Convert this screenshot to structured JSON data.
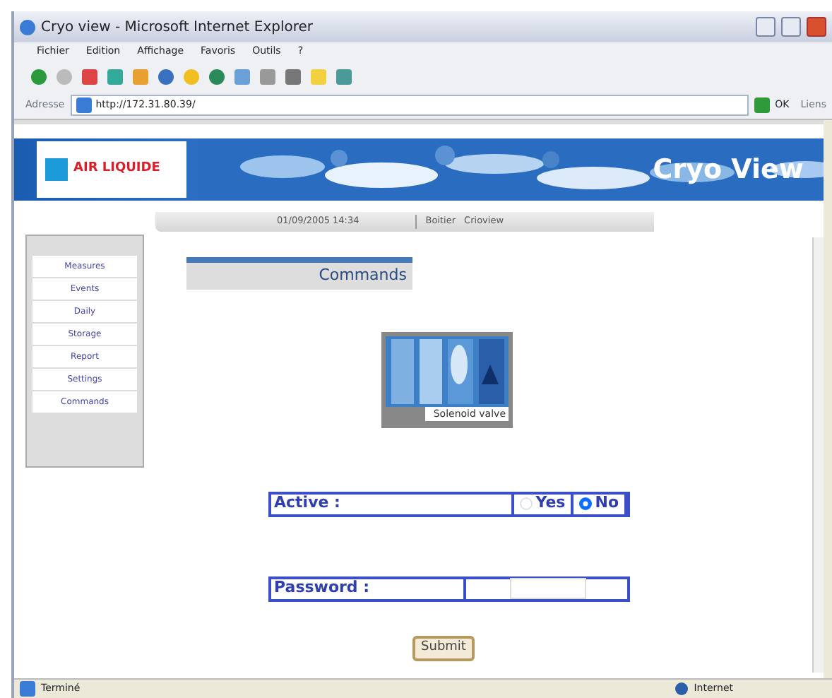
{
  "window": {
    "title": "Cryo view - Microsoft Internet Explorer"
  },
  "menu": [
    "Fichier",
    "Edition",
    "Affichage",
    "Favoris",
    "Outils",
    "?"
  ],
  "address_bar": {
    "label": "Adresse",
    "value": "http://172.31.80.39/",
    "go": "OK",
    "links": "Liens"
  },
  "banner": {
    "logo": "AIR LIQUIDE",
    "title": "Cryo View"
  },
  "info_bar": {
    "datetime": "01/09/2005 14:34",
    "device_label": "Boitier",
    "device": "Crioview"
  },
  "sidebar": {
    "items": [
      "Measures",
      "Events",
      "Daily",
      "Storage",
      "Report",
      "Settings",
      "Commands"
    ]
  },
  "page_title": "Commands",
  "device": {
    "caption": "Solenoid valve"
  },
  "active": {
    "label": "Active :",
    "options": [
      {
        "label": "Yes",
        "selected": false
      },
      {
        "label": "No",
        "selected": true
      }
    ]
  },
  "password": {
    "label": "Password :"
  },
  "submit": "Submit",
  "status_bar": {
    "text": "Terminé",
    "zone": "Internet"
  }
}
